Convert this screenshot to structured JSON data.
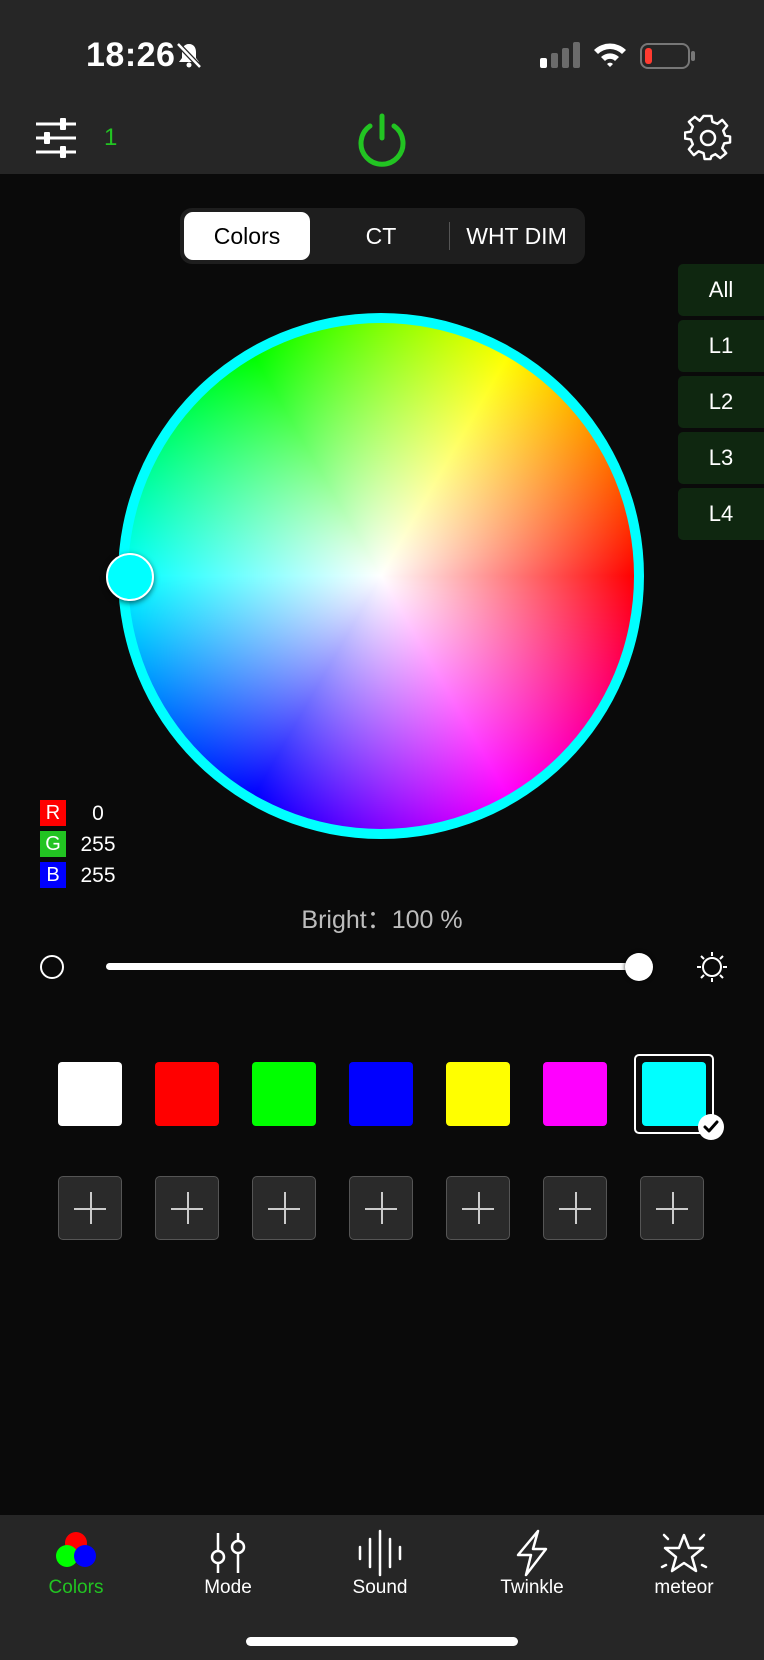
{
  "status": {
    "time": "18:26"
  },
  "header": {
    "group_number": "1"
  },
  "tabs": [
    {
      "label": "Colors",
      "active": true
    },
    {
      "label": "CT",
      "active": false
    },
    {
      "label": "WHT DIM",
      "active": false
    }
  ],
  "zones": [
    "All",
    "L1",
    "L2",
    "L3",
    "L4"
  ],
  "color": {
    "selected": "#00ffff",
    "rgb": [
      {
        "label": "R",
        "value": "0",
        "badge_color": "#ff0000"
      },
      {
        "label": "G",
        "value": "255",
        "badge_color": "#22c422"
      },
      {
        "label": "B",
        "value": "255",
        "badge_color": "#0000ff"
      }
    ]
  },
  "brightness": {
    "text": "Bright：100 %",
    "value_percent": 100
  },
  "presets": [
    "#ffffff",
    "#ff0000",
    "#00ff00",
    "#0000ff",
    "#ffff00",
    "#ff00ff",
    "#00ffff"
  ],
  "selected_preset_index": 6,
  "custom_slots": 7,
  "bottom_nav": [
    {
      "label": "Colors",
      "icon": "rgb-circles-icon",
      "active": true
    },
    {
      "label": "Mode",
      "icon": "mode-sliders-icon",
      "active": false
    },
    {
      "label": "Sound",
      "icon": "sound-bars-icon",
      "active": false
    },
    {
      "label": "Twinkle",
      "icon": "lightning-icon",
      "active": false
    },
    {
      "label": "meteor",
      "icon": "star-icon",
      "active": false
    }
  ],
  "colors": {
    "accent": "#22c422",
    "panel": "#262626",
    "background": "#0a0a0a"
  }
}
